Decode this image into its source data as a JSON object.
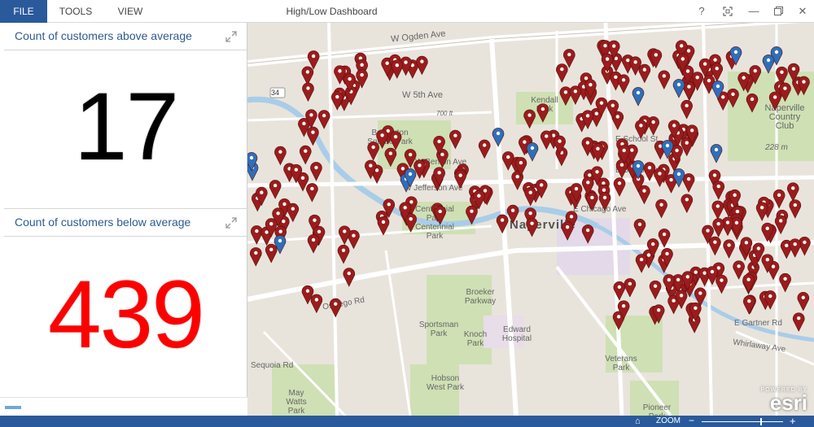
{
  "menu": {
    "file": "FILE",
    "tools": "TOOLS",
    "view": "VIEW"
  },
  "window": {
    "title": "High/Low Dashboard",
    "help": "?",
    "minimize": "—",
    "close": "✕"
  },
  "panels": {
    "above": {
      "title": "Count of customers above average",
      "value": "17",
      "color": "#000000"
    },
    "below": {
      "title": "Count of customers below average",
      "value": "439",
      "color": "#ff0000"
    }
  },
  "map": {
    "labels": {
      "ogden": "W Ogden Ave",
      "fifth": "W 5th Ave",
      "kendall": "Kendall Park",
      "burlington": "Burlington Square Park",
      "centennial": "Centennial Park Centennial Park",
      "naperville": "Naperville",
      "country_club": "Naperville Country Club",
      "elev": "228 m",
      "elev2": "700 ft",
      "broeker": "Broeker Parkway",
      "sportsman": "Sportsman Park",
      "knoch": "Knoch Park",
      "edward": "Edward Hospital",
      "hobson": "Hobson West Park",
      "may_watts": "May Watts Park",
      "veterans": "Veterans Park",
      "pioneer": "Pioneer Park",
      "oswego": "Oswego Rd",
      "sequoia": "Sequoia Rd",
      "gartner": "E Gartner Rd",
      "whirlaway": "Whirlaway Ave",
      "chicago": "E Chicago Ave",
      "benton": "W Benton Ave",
      "jefferson": "W Jefferson Ave",
      "schoolst": "E School St",
      "bailey": "E Benton Ave",
      "route": "34"
    },
    "marker_colors": {
      "high": "#2e6fba",
      "low": "#9b1c1c"
    },
    "attribution": {
      "powered": "POWERED BY",
      "brand": "esri"
    }
  },
  "status": {
    "home_icon": "home-icon",
    "zoom_label": "ZOOM",
    "zoom_minus": "−",
    "zoom_plus": "+",
    "zoom_level": 0.72
  }
}
